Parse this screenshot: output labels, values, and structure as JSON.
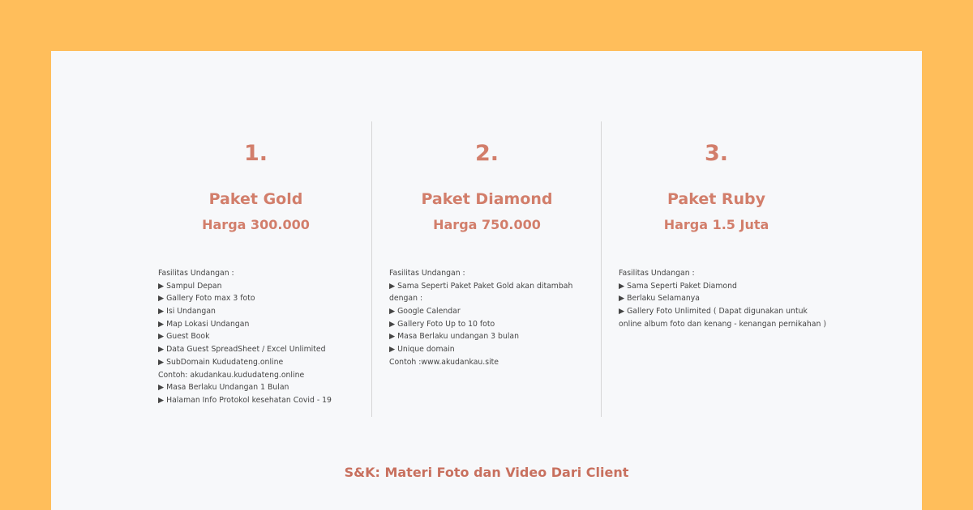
{
  "packages": [
    {
      "number": "1.",
      "title": "Paket Gold",
      "price": "Harga 300.000",
      "lines": [
        "Fasilitas Undangan :",
        "▶ Sampul Depan",
        "▶ Gallery Foto max 3 foto",
        "▶ Isi Undangan",
        "▶ Map Lokasi Undangan",
        "▶ Guest Book",
        "▶ Data Guest SpreadSheet / Excel Unlimited",
        "▶ SubDomain Kududateng.online",
        "Contoh: akudankau.kududateng.online",
        "▶ Masa Berlaku Undangan 1 Bulan",
        "▶ Halaman Info Protokol kesehatan Covid - 19"
      ]
    },
    {
      "number": "2.",
      "title": "Paket Diamond",
      "price": "Harga 750.000",
      "lines": [
        "Fasilitas Undangan :",
        "▶ Sama Seperti Paket Paket Gold akan ditambah",
        "dengan :",
        "▶ Google Calendar",
        "▶ Gallery Foto Up to 10 foto",
        "▶ Masa Berlaku undangan 3 bulan",
        "▶ Unique domain",
        "Contoh :www.akudankau.site"
      ]
    },
    {
      "number": "3.",
      "title": "Paket Ruby",
      "price": "Harga 1.5 Juta",
      "lines": [
        "Fasilitas Undangan :",
        "▶ Sama Seperti Paket Diamond",
        "▶ Berlaku Selamanya",
        "▶ Gallery Foto Unlimited    ( Dapat digunakan untuk",
        "online album foto dan kenang - kenangan pernikahan )"
      ]
    }
  ],
  "footer": "S&K: Materi Foto dan Video Dari Client",
  "colors": {
    "background": "#FFBE5B",
    "card": "#F7F8FA",
    "accent": "#D27E6B"
  }
}
